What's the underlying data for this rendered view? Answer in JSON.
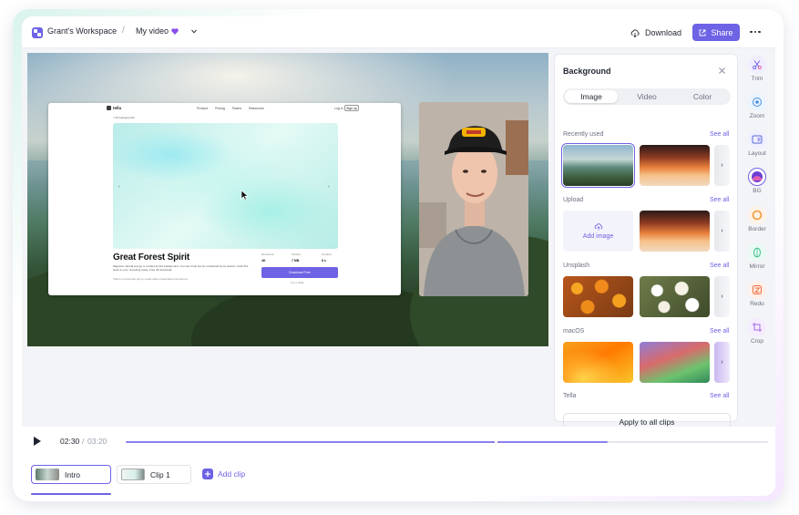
{
  "header": {
    "workspace": "Grant's Workspace",
    "separator": "/",
    "video_title": "My video",
    "download_label": "Download",
    "share_label": "Share"
  },
  "slide": {
    "logo": "tella",
    "nav_links": [
      "Product",
      "Pricing",
      "Teams",
      "Resources"
    ],
    "login": "Log in",
    "signup": "Sign up",
    "back": "< All backgrounds",
    "title": "Great Forest Spirit",
    "description": "Magnetic natural energy is emitted by this background. You can't help but be enchanted by its powers. Grab this spell on your recording today. Free 4K download.",
    "footer_note": "Tella is a screencast app to create video presentations and demos.",
    "stats": [
      {
        "label": "Resolution",
        "value": "4K"
      },
      {
        "label": "Filesize",
        "value": "7 MB"
      },
      {
        "label": "Duration",
        "value": "8 s"
      }
    ],
    "download_button": "Download Free",
    "try_label": "Try in Tella"
  },
  "panel": {
    "title": "Background",
    "tabs": [
      "Image",
      "Video",
      "Color"
    ],
    "active_tab": "Image",
    "see_all": "See all",
    "sections": [
      "Recently used",
      "Upload",
      "Unsplash",
      "macOS",
      "Tella"
    ],
    "add_image": "Add image",
    "apply_button": "Apply to all clips"
  },
  "tools": [
    "Trim",
    "Zoom",
    "Layout",
    "BG",
    "Border",
    "Mirror",
    "Redo",
    "Crop"
  ],
  "timeline": {
    "current_time": "02:30",
    "separator": "/",
    "total_time": "03:20",
    "progress": 0.75
  },
  "clips": {
    "items": [
      "Intro",
      "Clip 1"
    ],
    "add_clip": "Add clip"
  },
  "colors": {
    "accent": "#6e62e5"
  }
}
